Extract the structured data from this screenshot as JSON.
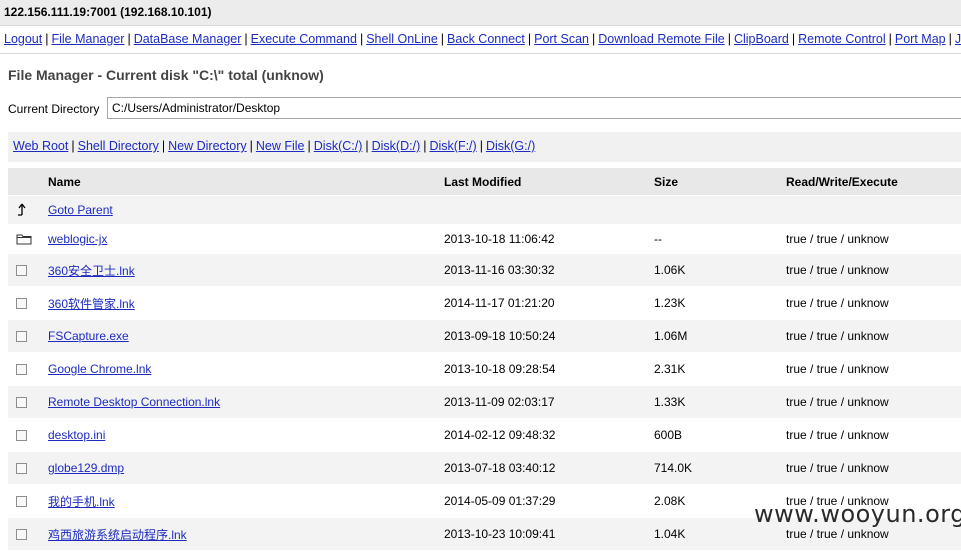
{
  "window": {
    "host": "122.156.111.19:7001 (192.168.10.101)"
  },
  "nav": [
    "Logout",
    "File Manager",
    "DataBase Manager",
    "Execute Command",
    "Shell OnLine",
    "Back Connect",
    "Port Scan",
    "Download Remote File",
    "ClipBoard",
    "Remote Control",
    "Port Map",
    "JSP"
  ],
  "page": {
    "title": "File Manager - Current disk \"C:\\\" total (unknow)",
    "current_dir_label": "Current Directory",
    "current_dir_value": "C:/Users/Administrator/Desktop"
  },
  "quicklinks": [
    "Web Root",
    "Shell Directory",
    "New Directory",
    "New File",
    "Disk(C:/)",
    "Disk(D:/)",
    "Disk(F:/)",
    "Disk(G:/)"
  ],
  "table": {
    "headers": {
      "name": "Name",
      "modified": "Last Modified",
      "size": "Size",
      "rwx": "Read/Write/Execute"
    },
    "parent_label": "Goto Parent",
    "rows": [
      {
        "type": "folder",
        "name": "weblogic-jx",
        "modified": "2013-10-18 11:06:42",
        "size": "--",
        "rwx": "true / true / unknow"
      },
      {
        "type": "file",
        "name": "360安全卫士.lnk",
        "modified": "2013-11-16 03:30:32",
        "size": "1.06K",
        "rwx": "true / true / unknow"
      },
      {
        "type": "file",
        "name": "360软件管家.lnk",
        "modified": "2014-11-17 01:21:20",
        "size": "1.23K",
        "rwx": "true / true / unknow"
      },
      {
        "type": "file",
        "name": "FSCapture.exe",
        "modified": "2013-09-18 10:50:24",
        "size": "1.06M",
        "rwx": "true / true / unknow"
      },
      {
        "type": "file",
        "name": "Google Chrome.lnk",
        "modified": "2013-10-18 09:28:54",
        "size": "2.31K",
        "rwx": "true / true / unknow"
      },
      {
        "type": "file",
        "name": "Remote Desktop Connection.lnk",
        "modified": "2013-11-09 02:03:17",
        "size": "1.33K",
        "rwx": "true / true / unknow"
      },
      {
        "type": "file",
        "name": "desktop.ini",
        "modified": "2014-02-12 09:48:32",
        "size": "600B",
        "rwx": "true / true / unknow"
      },
      {
        "type": "file",
        "name": "globe129.dmp",
        "modified": "2013-07-18 03:40:12",
        "size": "714.0K",
        "rwx": "true / true / unknow"
      },
      {
        "type": "file",
        "name": "我的手机.lnk",
        "modified": "2014-05-09 01:37:29",
        "size": "2.08K",
        "rwx": "true / true / unknow"
      },
      {
        "type": "file",
        "name": "鸡西旅游系统启动程序.lnk",
        "modified": "2013-10-23 10:09:41",
        "size": "1.04K",
        "rwx": "true / true / unknow"
      }
    ]
  },
  "watermark": "www.wooyun.org"
}
